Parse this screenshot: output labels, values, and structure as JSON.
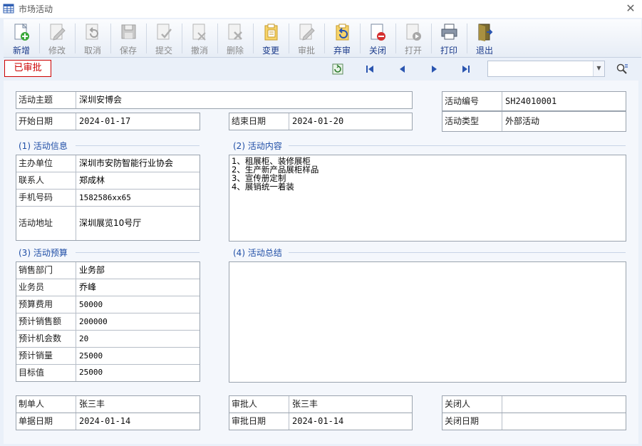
{
  "window": {
    "title": "市场活动"
  },
  "toolbar": {
    "buttons": [
      {
        "label": "新增",
        "icon": "new-icon",
        "enabled": true
      },
      {
        "label": "修改",
        "icon": "edit-icon",
        "enabled": false
      },
      {
        "label": "取消",
        "icon": "undo-icon",
        "enabled": false
      },
      {
        "label": "保存",
        "icon": "save-icon",
        "enabled": false
      },
      {
        "label": "提交",
        "icon": "submit-icon",
        "enabled": false
      },
      {
        "label": "撤消",
        "icon": "revoke-icon",
        "enabled": false
      },
      {
        "label": "删除",
        "icon": "delete-icon",
        "enabled": false
      },
      {
        "label": "变更",
        "icon": "change-icon",
        "enabled": true
      },
      {
        "label": "审批",
        "icon": "approve-icon",
        "enabled": false
      },
      {
        "label": "弃审",
        "icon": "unapprove-icon",
        "enabled": true
      },
      {
        "label": "关闭",
        "icon": "close-doc-icon",
        "enabled": true
      },
      {
        "label": "打开",
        "icon": "open-icon",
        "enabled": false
      },
      {
        "label": "打印",
        "icon": "print-icon",
        "enabled": true
      },
      {
        "label": "退出",
        "icon": "exit-icon",
        "enabled": true
      }
    ]
  },
  "status": {
    "label": "已审批",
    "color": "#cc0000"
  },
  "search": {
    "value": "",
    "placeholder": ""
  },
  "header": {
    "subject_label": "活动主题",
    "subject": "深圳安博会",
    "code_label": "活动编号",
    "code": "SH24010001",
    "start_label": "开始日期",
    "start": "2024-01-17",
    "end_label": "结束日期",
    "end": "2024-01-20",
    "type_label": "活动类型",
    "type": "外部活动"
  },
  "info": {
    "title": "(1) 活动信息",
    "rows": [
      {
        "label": "主办单位",
        "value": "深圳市安防智能行业协会"
      },
      {
        "label": "联系人",
        "value": "郑成林"
      },
      {
        "label": "手机号码",
        "value": "1582586xx65"
      },
      {
        "label": "活动地址",
        "value": "深圳展览10号厅"
      }
    ]
  },
  "content": {
    "title": "(2) 活动内容",
    "lines": [
      "1、租展柜、装修展柜",
      "2、生产新产品展柜样品",
      "3、宣传册定制",
      "4、展销统一着装"
    ]
  },
  "budget": {
    "title": "(3) 活动预算",
    "rows": [
      {
        "label": "销售部门",
        "value": "业务部"
      },
      {
        "label": "业务员",
        "value": "乔峰"
      },
      {
        "label": "预算费用",
        "value": "50000"
      },
      {
        "label": "预计销售额",
        "value": "200000"
      },
      {
        "label": "预计机会数",
        "value": "20"
      },
      {
        "label": "预计销量",
        "value": "25000"
      },
      {
        "label": "目标值",
        "value": "25000"
      }
    ]
  },
  "summary": {
    "title": "(4) 活动总结",
    "text": ""
  },
  "footer": {
    "maker_label": "制单人",
    "maker": "张三丰",
    "doc_date_label": "单据日期",
    "doc_date": "2024-01-14",
    "approver_label": "审批人",
    "approver": "张三丰",
    "approve_date_label": "审批日期",
    "approve_date": "2024-01-14",
    "closer_label": "关闭人",
    "closer": "",
    "close_date_label": "关闭日期",
    "close_date": ""
  }
}
